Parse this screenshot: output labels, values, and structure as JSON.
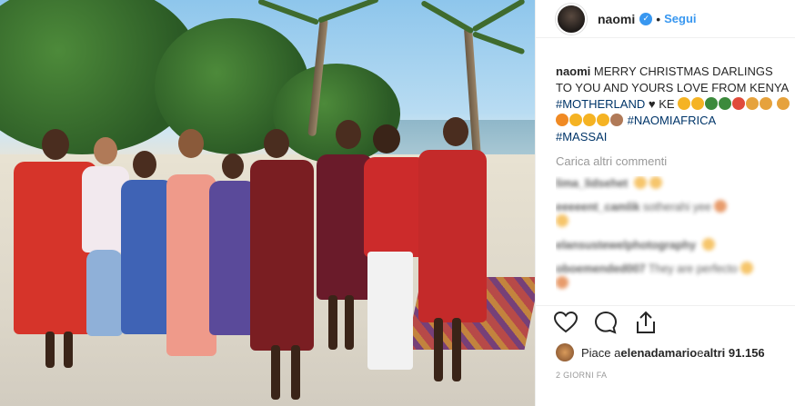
{
  "post": {
    "username": "naomi",
    "separator": "•",
    "follow_label": "Segui",
    "caption": {
      "author": "naomi",
      "text": "MERRY CHRISTMAS DARLINGS TO YOU AND YOURS LOVE FROM KENYA",
      "hashtag_1": "#MOTHERLAND",
      "inline": "♥ KE",
      "hashtag_2": "#NAOMIAFRICA",
      "hashtag_3": "#MASSAI"
    },
    "load_more": "Carica altri commenti",
    "comments": [
      {
        "user": "lima_lidsehet",
        "text": ""
      },
      {
        "user": "eeeeent_camlik",
        "text": "sotherahi yee"
      },
      {
        "user": "elansustewelphotography",
        "text": ""
      },
      {
        "user": "oboemended007",
        "text": "They are perfecto"
      }
    ],
    "likes": {
      "prefix": "Piace a ",
      "user": "elenadamario",
      "middle": " e ",
      "others": "altri 91.156"
    },
    "timestamp": "2 GIORNI FA"
  },
  "colors": {
    "accent": "#3897f0",
    "hashtag": "#003569",
    "muted": "#999999",
    "text": "#262626"
  },
  "icons": [
    "verified-badge-icon",
    "heart-icon",
    "comment-icon",
    "share-icon"
  ]
}
